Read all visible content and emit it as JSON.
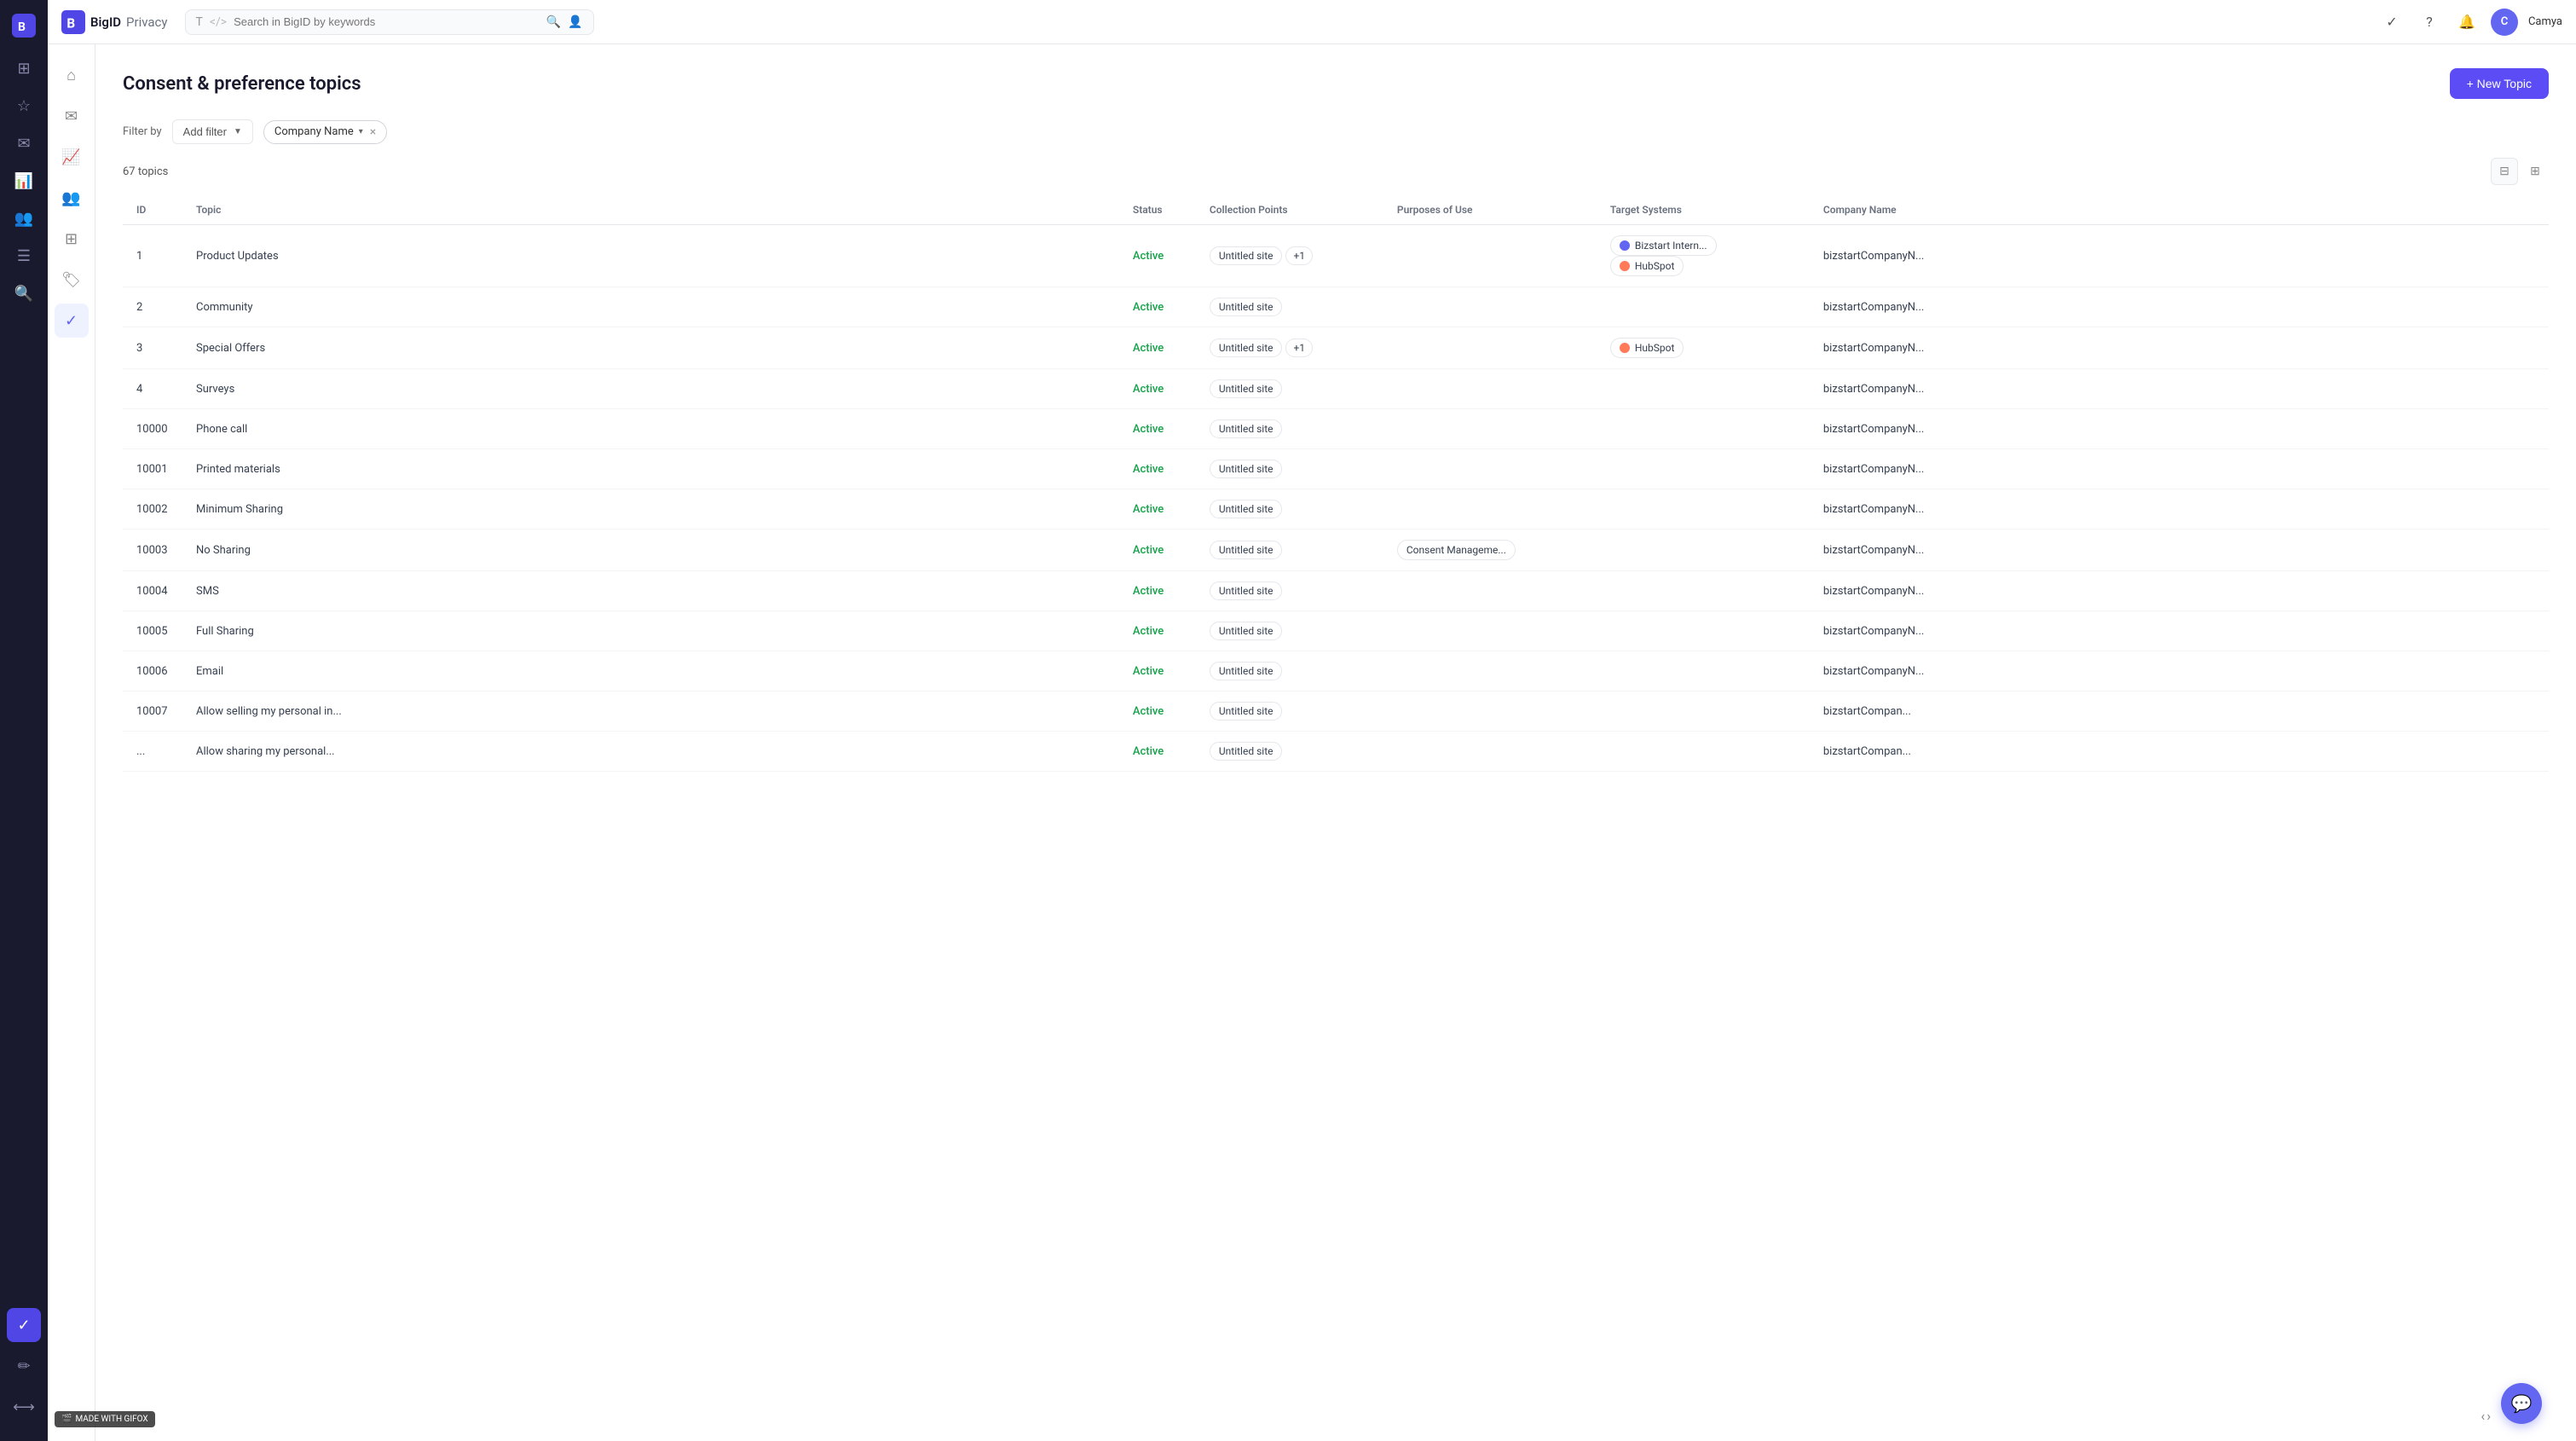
{
  "app": {
    "name": "BigID",
    "subtitle": "Privacy",
    "logo_letter": "B"
  },
  "topbar": {
    "search_placeholder": "Search in BigID by keywords",
    "user_initial": "C",
    "user_name": "Camya"
  },
  "sidebar": {
    "icons": [
      "grid",
      "star",
      "mail",
      "chart",
      "users",
      "list",
      "search",
      "consent"
    ]
  },
  "page": {
    "title": "Consent & preference topics",
    "new_topic_label": "+ New Topic"
  },
  "filter": {
    "by_label": "Filter by",
    "add_filter_label": "Add filter",
    "active_filter_label": "Company Name"
  },
  "table": {
    "topics_count": "67 topics",
    "columns": [
      "ID",
      "Topic",
      "Status",
      "Collection Points",
      "Purposes of Use",
      "Target Systems",
      "Company Name"
    ],
    "rows": [
      {
        "id": "1",
        "topic": "Product Updates",
        "status": "Active",
        "collection_points": [
          "Untitled site"
        ],
        "collection_extra": "+1",
        "purposes": [],
        "target_systems": [
          "Bizstart Intern...",
          "HubSpot"
        ],
        "company": "bizstartCompanyN..."
      },
      {
        "id": "2",
        "topic": "Community",
        "status": "Active",
        "collection_points": [
          "Untitled site"
        ],
        "collection_extra": "",
        "purposes": [],
        "target_systems": [],
        "company": "bizstartCompanyN..."
      },
      {
        "id": "3",
        "topic": "Special Offers",
        "status": "Active",
        "collection_points": [
          "Untitled site"
        ],
        "collection_extra": "+1",
        "purposes": [],
        "target_systems": [
          "HubSpot"
        ],
        "company": "bizstartCompanyN..."
      },
      {
        "id": "4",
        "topic": "Surveys",
        "status": "Active",
        "collection_points": [
          "Untitled site"
        ],
        "collection_extra": "",
        "purposes": [],
        "target_systems": [],
        "company": "bizstartCompanyN..."
      },
      {
        "id": "10000",
        "topic": "Phone call",
        "status": "Active",
        "collection_points": [
          "Untitled site"
        ],
        "collection_extra": "",
        "purposes": [],
        "target_systems": [],
        "company": "bizstartCompanyN..."
      },
      {
        "id": "10001",
        "topic": "Printed materials",
        "status": "Active",
        "collection_points": [
          "Untitled site"
        ],
        "collection_extra": "",
        "purposes": [],
        "target_systems": [],
        "company": "bizstartCompanyN..."
      },
      {
        "id": "10002",
        "topic": "Minimum Sharing",
        "status": "Active",
        "collection_points": [
          "Untitled site"
        ],
        "collection_extra": "",
        "purposes": [],
        "target_systems": [],
        "company": "bizstartCompanyN..."
      },
      {
        "id": "10003",
        "topic": "No Sharing",
        "status": "Active",
        "collection_points": [
          "Untitled site"
        ],
        "collection_extra": "",
        "purposes": [
          "Consent Manageme..."
        ],
        "target_systems": [],
        "company": "bizstartCompanyN..."
      },
      {
        "id": "10004",
        "topic": "SMS",
        "status": "Active",
        "collection_points": [
          "Untitled site"
        ],
        "collection_extra": "",
        "purposes": [],
        "target_systems": [],
        "company": "bizstartCompanyN..."
      },
      {
        "id": "10005",
        "topic": "Full Sharing",
        "status": "Active",
        "collection_points": [
          "Untitled site"
        ],
        "collection_extra": "",
        "purposes": [],
        "target_systems": [],
        "company": "bizstartCompanyN..."
      },
      {
        "id": "10006",
        "topic": "Email",
        "status": "Active",
        "collection_points": [
          "Untitled site"
        ],
        "collection_extra": "",
        "purposes": [],
        "target_systems": [],
        "company": "bizstartCompanyN..."
      },
      {
        "id": "10007",
        "topic": "Allow selling my personal in...",
        "status": "Active",
        "collection_points": [
          "Untitled site"
        ],
        "collection_extra": "",
        "purposes": [],
        "target_systems": [],
        "company": "bizstartCompan..."
      },
      {
        "id": "...",
        "topic": "Allow sharing my personal...",
        "status": "Active",
        "collection_points": [
          "Untitled site"
        ],
        "collection_extra": "",
        "purposes": [],
        "target_systems": [],
        "company": "bizstartCompan..."
      }
    ]
  }
}
